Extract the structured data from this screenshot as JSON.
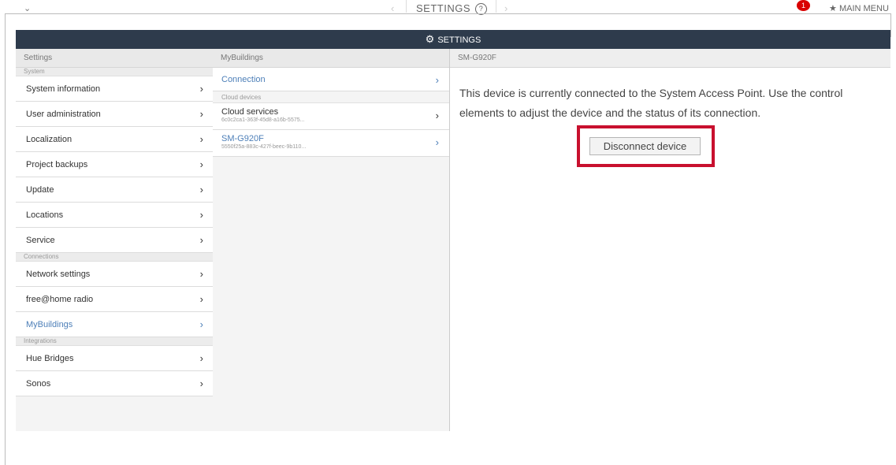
{
  "topbar": {
    "collapse_icon": "chevron-down-icon",
    "prev_arrow": "‹",
    "title": "SETTINGS",
    "help_glyph": "?",
    "next_arrow": "›",
    "badge": "1",
    "main_menu": "MAIN MENU",
    "main_menu_icon": "star-icon"
  },
  "header": {
    "title": "SETTINGS",
    "icon": "gear-icon"
  },
  "col1": {
    "title": "Settings",
    "sections": [
      {
        "label": "System",
        "items": [
          "System information",
          "User administration",
          "Localization",
          "Project backups",
          "Update",
          "Locations",
          "Service"
        ]
      },
      {
        "label": "Connections",
        "items": [
          "Network settings",
          "free@home radio",
          "MyBuildings"
        ]
      },
      {
        "label": "Integrations",
        "items": [
          "Hue Bridges",
          "Sonos"
        ]
      }
    ],
    "active": "MyBuildings"
  },
  "col2": {
    "title": "MyBuildings",
    "connection": "Connection",
    "section": "Cloud devices",
    "devices": [
      {
        "name": "Cloud services",
        "id": "6c0c2ca1-363f-45d8-a16b-5575..."
      },
      {
        "name": "SM-G920F",
        "id": "5550f25a-883c-427f-beec-9b110..."
      }
    ]
  },
  "col3": {
    "title": "SM-G920F",
    "message": "This device is currently connected to the System Access Point. Use the control elements to adjust the device and the status of its connection.",
    "disconnect_label": "Disconnect device",
    "highlight_color": "#c8102e"
  },
  "colors": {
    "header_bg": "#2e3b4c",
    "accent": "#4d7fb8"
  }
}
